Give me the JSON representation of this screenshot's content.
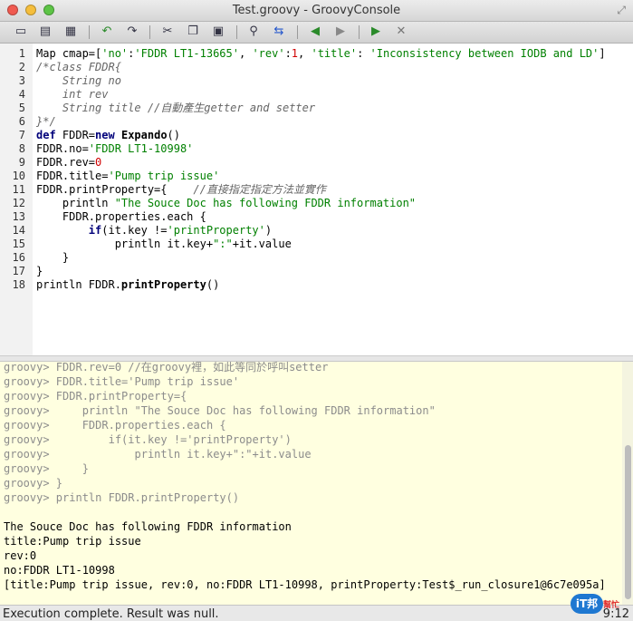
{
  "window": {
    "title": "Test.groovy - GroovyConsole"
  },
  "toolbar": {
    "icons": [
      "new-file",
      "open-file",
      "save-file",
      "undo",
      "redo",
      "cut",
      "copy",
      "paste",
      "find",
      "replace",
      "history-prev",
      "history-next",
      "run-script",
      "interrupt"
    ]
  },
  "editor": {
    "lines": [
      {
        "n": "1",
        "parts": [
          [
            "p",
            "Map cmap=["
          ],
          [
            "s",
            "'no'"
          ],
          [
            "p",
            ":"
          ],
          [
            "s",
            "'FDDR LT1-13665'"
          ],
          [
            "p",
            ", "
          ],
          [
            "s",
            "'rev'"
          ],
          [
            "p",
            ":"
          ],
          [
            "n",
            "1"
          ],
          [
            "p",
            ", "
          ],
          [
            "s",
            "'title'"
          ],
          [
            "p",
            ": "
          ],
          [
            "s",
            "'Inconsistency between IODB and LD'"
          ],
          [
            "p",
            "]"
          ]
        ]
      },
      {
        "n": "2",
        "parts": [
          [
            "c",
            "/*class FDDR{"
          ]
        ]
      },
      {
        "n": "3",
        "parts": [
          [
            "c",
            "    String no"
          ]
        ]
      },
      {
        "n": "4",
        "parts": [
          [
            "c",
            "    int rev"
          ]
        ]
      },
      {
        "n": "5",
        "parts": [
          [
            "c",
            "    String title //自動產生getter and setter"
          ]
        ]
      },
      {
        "n": "6",
        "parts": [
          [
            "c",
            "}*/"
          ]
        ]
      },
      {
        "n": "7",
        "parts": [
          [
            "k",
            "def"
          ],
          [
            "p",
            " FDDR="
          ],
          [
            "k",
            "new"
          ],
          [
            "p",
            " "
          ],
          [
            "b",
            "Expando"
          ],
          [
            "p",
            "()"
          ]
        ]
      },
      {
        "n": "8",
        "parts": [
          [
            "p",
            "FDDR.no="
          ],
          [
            "s",
            "'FDDR LT1-10998'"
          ]
        ]
      },
      {
        "n": "9",
        "parts": [
          [
            "p",
            "FDDR.rev="
          ],
          [
            "n",
            "0"
          ]
        ]
      },
      {
        "n": "10",
        "parts": [
          [
            "p",
            "FDDR.title="
          ],
          [
            "s",
            "'Pump trip issue'"
          ]
        ]
      },
      {
        "n": "11",
        "parts": [
          [
            "p",
            "FDDR.printProperty={    "
          ],
          [
            "c",
            "//直接指定指定方法並實作"
          ]
        ]
      },
      {
        "n": "12",
        "parts": [
          [
            "p",
            "    println "
          ],
          [
            "s",
            "\"The Souce Doc has following FDDR information\""
          ]
        ]
      },
      {
        "n": "13",
        "parts": [
          [
            "p",
            "    FDDR.properties.each {"
          ]
        ]
      },
      {
        "n": "14",
        "parts": [
          [
            "p",
            "        "
          ],
          [
            "k",
            "if"
          ],
          [
            "p",
            "(it.key !="
          ],
          [
            "s",
            "'printProperty'"
          ],
          [
            "p",
            ")"
          ]
        ]
      },
      {
        "n": "15",
        "parts": [
          [
            "p",
            "            println it.key+"
          ],
          [
            "s",
            "\":\""
          ],
          [
            "p",
            "+it.value"
          ]
        ]
      },
      {
        "n": "16",
        "parts": [
          [
            "p",
            "    }"
          ]
        ]
      },
      {
        "n": "17",
        "parts": [
          [
            "p",
            "}"
          ]
        ]
      },
      {
        "n": "18",
        "parts": [
          [
            "p",
            "println FDDR."
          ],
          [
            "b",
            "printProperty"
          ],
          [
            "p",
            "()"
          ]
        ]
      }
    ]
  },
  "output": {
    "history_lines": [
      "groovy> FDDR.rev=0 //在groovy裡，如此等同於呼叫setter",
      "groovy> FDDR.title='Pump trip issue'",
      "groovy> FDDR.printProperty={",
      "groovy>     println \"The Souce Doc has following FDDR information\"",
      "groovy>     FDDR.properties.each {",
      "groovy>         if(it.key !='printProperty')",
      "groovy>             println it.key+\":\"+it.value",
      "groovy>     }",
      "groovy> }",
      "groovy> println FDDR.printProperty()"
    ],
    "result_lines": [
      "The Souce Doc has following FDDR information",
      "title:Pump trip issue",
      "rev:0",
      "no:FDDR LT1-10998",
      "[title:Pump trip issue, rev:0, no:FDDR LT1-10998, printProperty:Test$_run_closure1@6c7e095a]"
    ]
  },
  "status": {
    "message": "Execution complete. Result was null.",
    "position": "9:12"
  },
  "watermark": {
    "logo": "iT邦",
    "sub": "幫忙"
  }
}
